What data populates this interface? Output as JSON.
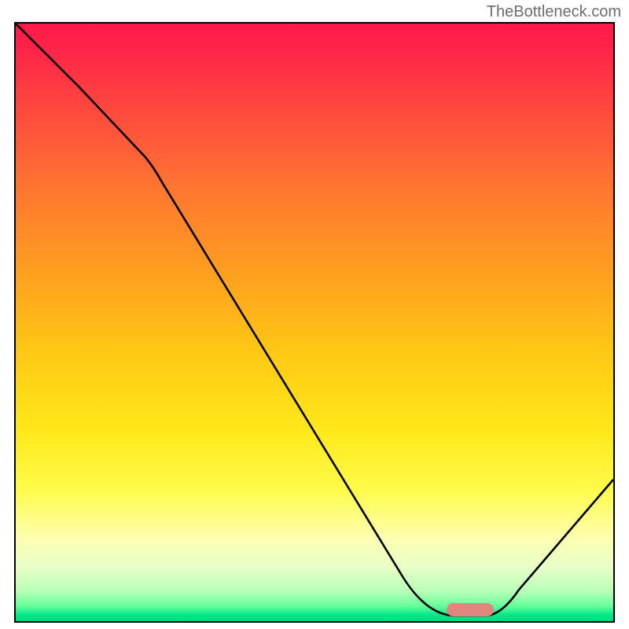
{
  "watermark": "TheBottleneck.com",
  "chart_data": {
    "type": "line",
    "title": "",
    "xlabel": "",
    "ylabel": "",
    "xlim": [
      0,
      100
    ],
    "ylim": [
      0,
      100
    ],
    "x": [
      0,
      5,
      10,
      15,
      20,
      25,
      30,
      35,
      40,
      45,
      50,
      55,
      60,
      65,
      70,
      72,
      75,
      78,
      80,
      85,
      90,
      95,
      100
    ],
    "values": [
      100,
      94,
      88,
      82,
      76,
      71,
      62,
      52,
      42,
      33,
      25,
      17,
      10,
      5,
      2,
      1,
      0.5,
      0.5,
      1,
      5,
      11,
      17,
      23
    ],
    "marker": {
      "x_start": 72,
      "x_end": 79,
      "y": 0.5
    },
    "gradient_stops": [
      {
        "pos": 0,
        "color": "#ff1a4a"
      },
      {
        "pos": 50,
        "color": "#ffcc14"
      },
      {
        "pos": 80,
        "color": "#ffff66"
      },
      {
        "pos": 100,
        "color": "#00d880"
      }
    ]
  }
}
